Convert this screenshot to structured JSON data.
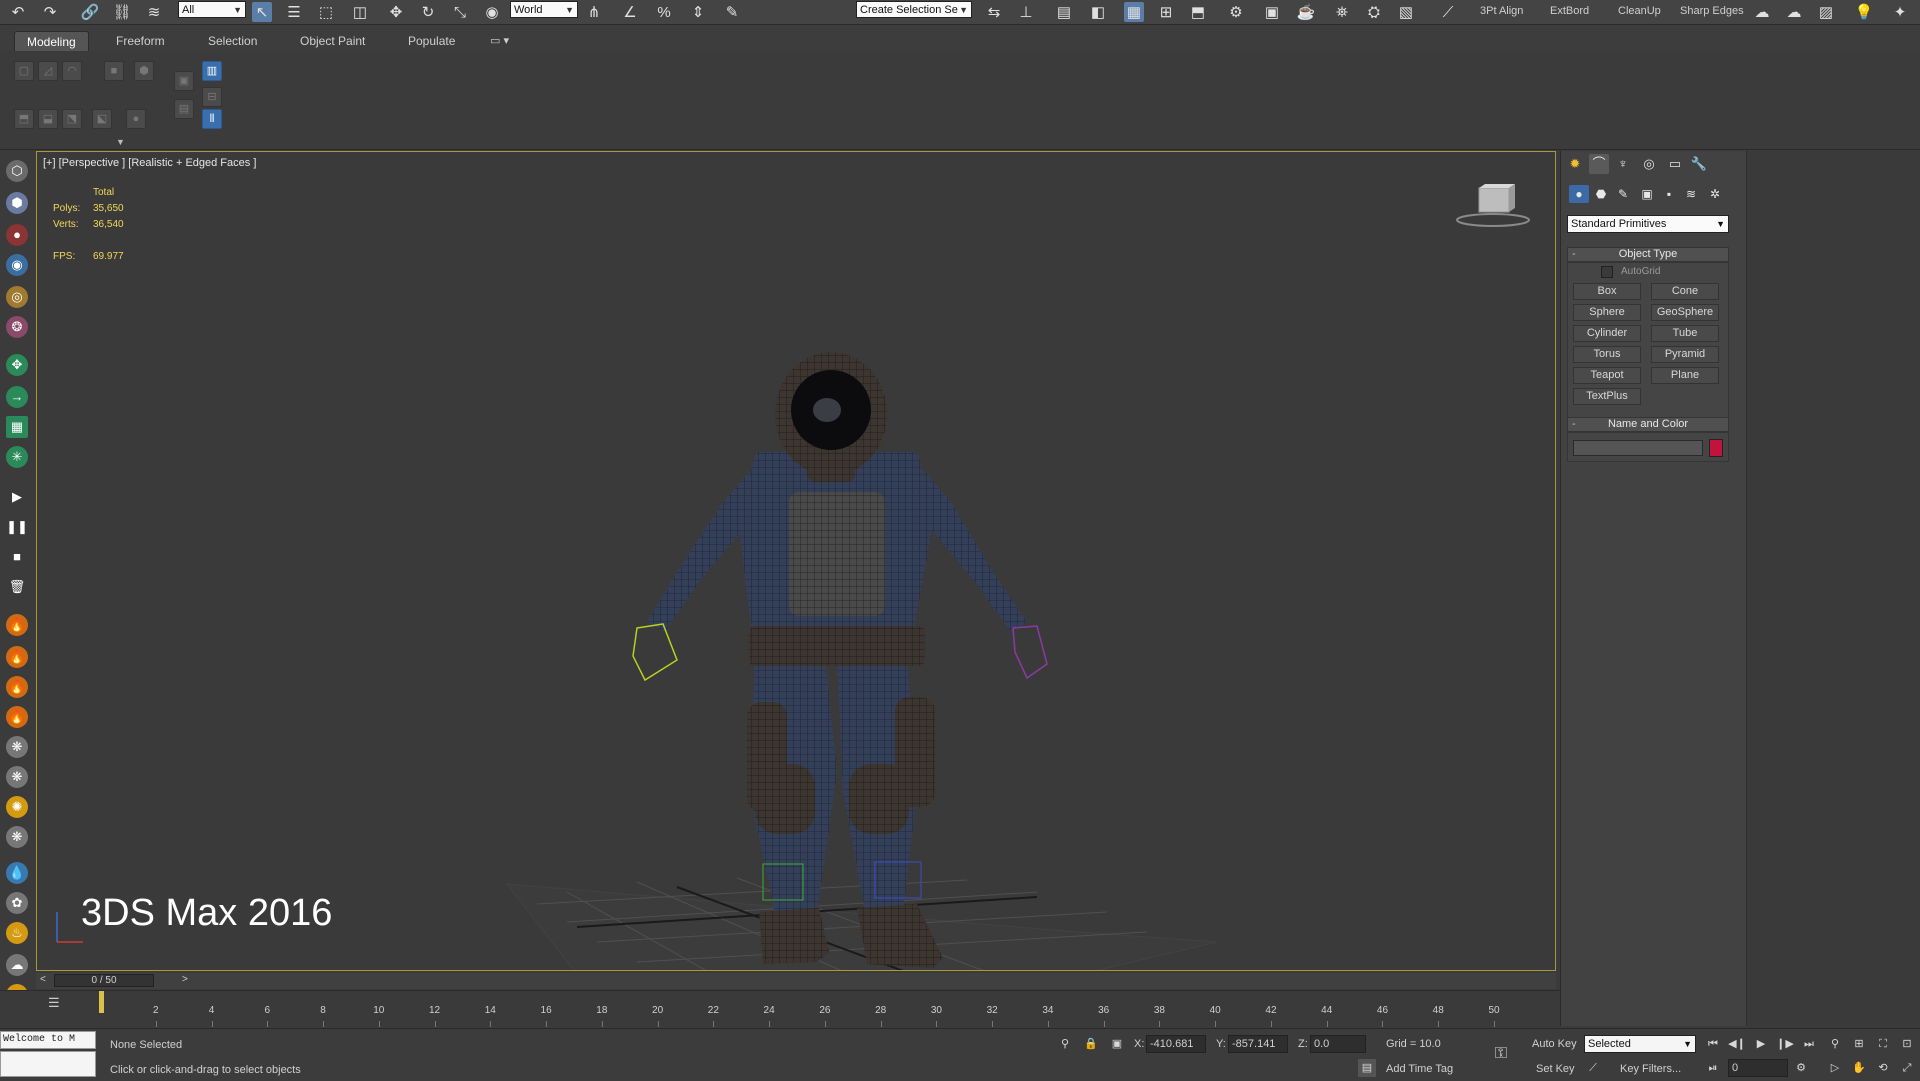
{
  "toolbar": {
    "selection_filter": "All",
    "coordinate_system": "World",
    "named_selection_placeholder": "Create Selection Se",
    "script_buttons": [
      "3Pt Align",
      "ExtBord",
      "CleanUp",
      "Sharp Edges"
    ],
    "icons": [
      "undo-icon",
      "redo-icon",
      "link-icon",
      "unlink-icon",
      "bind-spacewarp-icon",
      "select-icon",
      "select-by-name-icon",
      "rect-region-icon",
      "window-crossing-icon",
      "move-icon",
      "rotate-icon",
      "scale-icon",
      "pivot-icon",
      "snaps-3d-icon",
      "angle-snap-icon",
      "percent-snap-icon",
      "spinner-snap-icon",
      "edit-named-sets-icon",
      "mirror-icon",
      "align-icon",
      "layer-manager-icon",
      "graphite-icon",
      "curve-editor-icon",
      "schematic-icon",
      "material-editor-icon",
      "render-setup-icon",
      "rendered-frame-icon",
      "render-icon"
    ]
  },
  "ribbon": {
    "tabs": [
      "Modeling",
      "Freeform",
      "Selection",
      "Object Paint",
      "Populate"
    ],
    "active_tab": "Modeling"
  },
  "viewport": {
    "label": "[+] [Perspective ] [Realistic + Edged Faces ]",
    "stats": {
      "total_label": "Total",
      "polys_label": "Polys:",
      "polys_value": "35,650",
      "verts_label": "Verts:",
      "verts_value": "36,540",
      "fps_label": "FPS:",
      "fps_value": "69.977"
    },
    "watermark": "3DS Max 2016"
  },
  "command_panel": {
    "category_dropdown": "Standard Primitives",
    "object_type_title": "Object Type",
    "autogrid_label": "AutoGrid",
    "object_buttons": [
      "Box",
      "Cone",
      "Sphere",
      "GeoSphere",
      "Cylinder",
      "Tube",
      "Torus",
      "Pyramid",
      "Teapot",
      "Plane",
      "TextPlus"
    ],
    "name_color_title": "Name and Color",
    "object_color": "#c0143c"
  },
  "timeline": {
    "frame_display": "0 / 50",
    "ticks": [
      "2",
      "4",
      "6",
      "8",
      "10",
      "12",
      "14",
      "16",
      "18",
      "20",
      "22",
      "24",
      "26",
      "28",
      "30",
      "32",
      "34",
      "36",
      "38",
      "40",
      "42",
      "44",
      "46",
      "48",
      "50"
    ]
  },
  "status": {
    "listener_text": "Welcome to M",
    "selection_status": "None Selected",
    "prompt": "Click or click-and-drag to select objects",
    "x_label": "X:",
    "x_value": "-410.681",
    "y_label": "Y:",
    "y_value": "-857.141",
    "z_label": "Z:",
    "z_value": "0.0",
    "grid": "Grid = 10.0",
    "add_time_tag": "Add Time Tag",
    "auto_key": "Auto Key",
    "set_key": "Set Key",
    "key_mode": "Selected",
    "key_filters": "Key Filters...",
    "current_frame": "0"
  }
}
